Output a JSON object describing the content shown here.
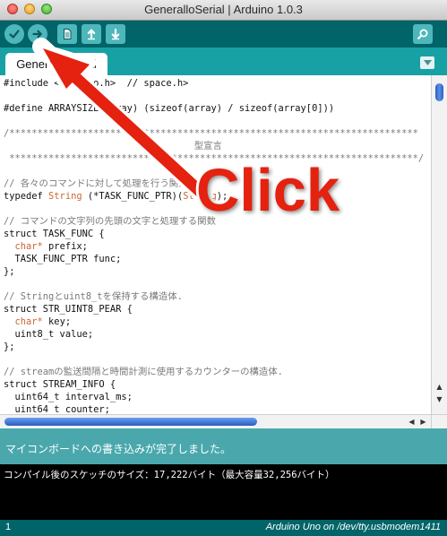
{
  "window": {
    "title": "GeneralloSerial | Arduino 1.0.3"
  },
  "toolbar": {
    "buttons": [
      {
        "name": "verify",
        "icon": "checkmark-icon"
      },
      {
        "name": "upload",
        "icon": "arrow-right-icon"
      },
      {
        "name": "new",
        "icon": "new-document-icon"
      },
      {
        "name": "open",
        "icon": "arrow-up-icon"
      },
      {
        "name": "save",
        "icon": "arrow-down-icon"
      },
      {
        "name": "serial-monitor",
        "icon": "magnifier-icon"
      }
    ]
  },
  "tabs": {
    "active_label": "GeneralloSerial",
    "visible_prefix": "Gener",
    "visible_suffix": "Serial"
  },
  "editor": {
    "lines": [
      "#include <Arduino.h>  // space.h>",
      "",
      "#define ARRAYSIZE(array) (sizeof(array) / sizeof(array[0]))",
      "",
      "/*************************************************************************",
      "                                  型宣言",
      " *************************************************************************/",
      "",
      "// 各々のコマンドに対して処理を行う関数",
      "typedef String (*TASK_FUNC_PTR)(String);",
      "",
      "// コマンドの文字列の先頭の文字と処理する関数",
      "struct TASK_FUNC {",
      "  char* prefix;",
      "  TASK_FUNC_PTR func;",
      "};",
      "",
      "// Stringとuint8_tを保持する構造体.",
      "struct STR_UINT8_PEAR {",
      "  char* key;",
      "  uint8_t value;",
      "};",
      "",
      "// streamの監送間隔と時間計測に使用するカウンターの構造体.",
      "struct STREAM_INFO {",
      "  uint64_t interval_ms;",
      "  uint64_t counter;"
    ]
  },
  "status": {
    "message": "マイコンボードへの書き込みが完了しました。"
  },
  "console": {
    "line": "コンパイル後のスケッチのサイズ：17,222バイト（最大容量32,256バイト）"
  },
  "footer": {
    "line_number": "1",
    "board": "Arduino Uno on /dev/tty.usbmodem1411"
  },
  "annotation": {
    "label": "Click",
    "color": "#e5210f"
  },
  "colors": {
    "toolbar": "#006468",
    "tabbar": "#17a1a5",
    "statusbar": "#4aa8ad",
    "button": "#4db7bb"
  }
}
